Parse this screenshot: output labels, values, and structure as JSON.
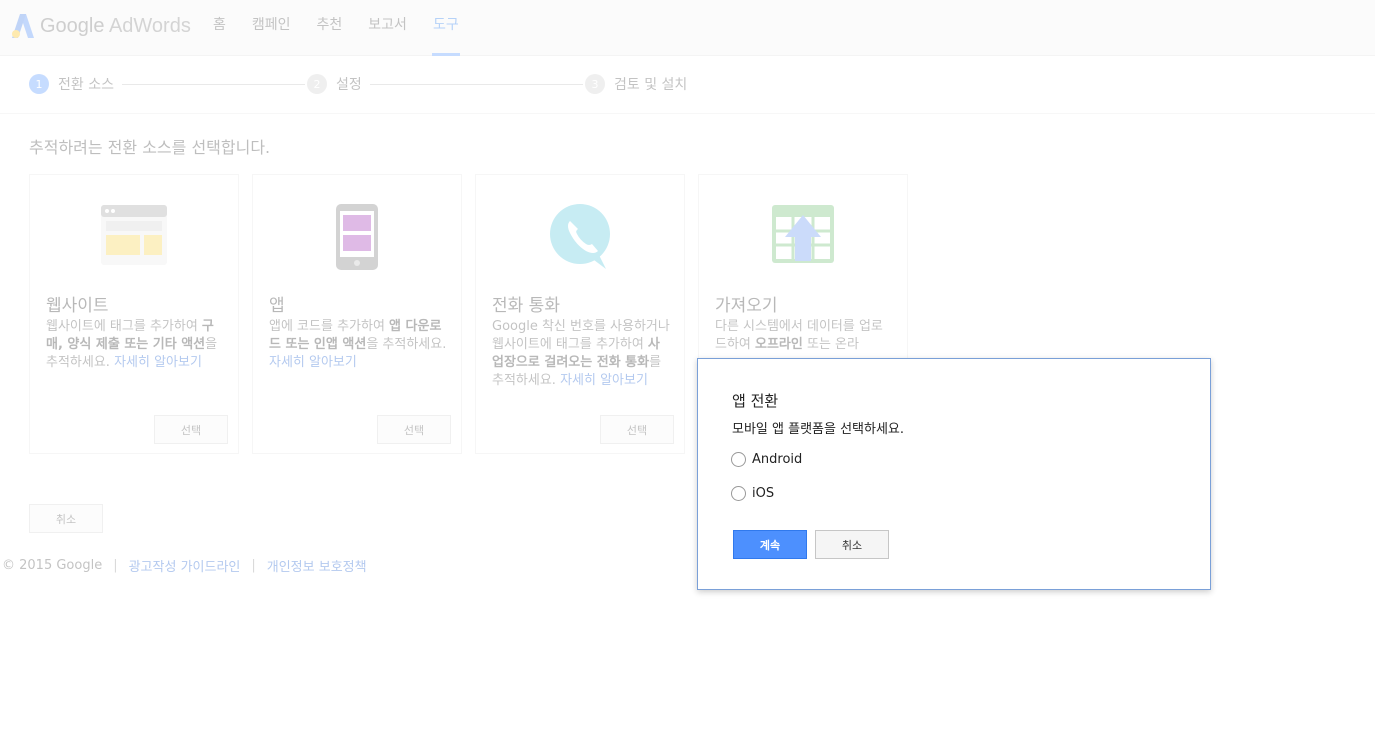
{
  "header": {
    "brand_google": "Google",
    "brand_product": "AdWords",
    "nav": [
      {
        "label": "홈"
      },
      {
        "label": "캠페인"
      },
      {
        "label": "추천"
      },
      {
        "label": "보고서"
      },
      {
        "label": "도구"
      }
    ],
    "active_nav": "도구"
  },
  "steps": [
    {
      "num": "1",
      "label": "전환 소스"
    },
    {
      "num": "2",
      "label": "설정"
    },
    {
      "num": "3",
      "label": "검토 및 설치"
    }
  ],
  "main": {
    "prompt": "추적하려는 전환 소스를 선택합니다.",
    "cards": [
      {
        "title": "웹사이트",
        "desc_1": "웹사이트에 태그를 추가하여 ",
        "desc_b1": "구매, 양식 제출 또는 기타 액션",
        "desc_2": "을 추적하세요. ",
        "link": "자세히 알아보기",
        "select": "선택",
        "icon": "website-icon"
      },
      {
        "title": "앱",
        "desc_1": "앱에 코드를 추가하여 ",
        "desc_b1": "앱 다운로드 또는 인앱 액션",
        "desc_2": "을 추적하세요. ",
        "link": "자세히 알아보기",
        "select": "선택",
        "icon": "mobile-app-icon"
      },
      {
        "title": "전화 통화",
        "desc_1": "Google 착신 번호를 사용하거나 웹사이트에 태그를 추가하여 ",
        "desc_b1": "사업장으로 걸려오는 전화 통화",
        "desc_2": "를 추적하세요. ",
        "link": "자세히 알아보기",
        "select": "선택",
        "icon": "phone-call-icon"
      },
      {
        "title": "가져오기",
        "desc_1": "다른 시스템에서 데이터를 업로드하여 ",
        "desc_b1": "오프라인",
        "desc_2": " 또는 온라",
        "link": "",
        "select": "",
        "icon": "import-icon"
      }
    ],
    "cancel": "취소"
  },
  "footer": {
    "copyright": "© 2015 Google",
    "sep": "|",
    "link1": "광고작성 가이드라인",
    "link2": "개인정보 보호정책"
  },
  "dialog": {
    "title": "앱 전환",
    "subtitle": "모바일 앱 플랫폼을 선택하세요.",
    "options": [
      {
        "label": "Android"
      },
      {
        "label": "iOS"
      }
    ],
    "continue": "계속",
    "cancel": "취소"
  },
  "colors": {
    "accent": "#4d90fe",
    "link": "#1155cc"
  }
}
